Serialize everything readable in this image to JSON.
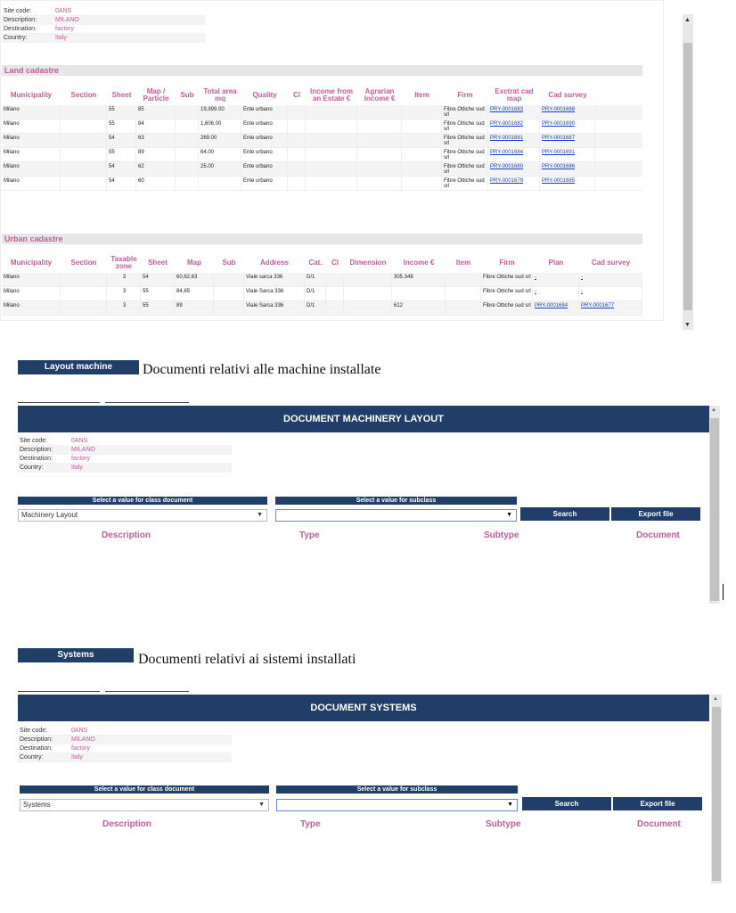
{
  "site": {
    "site_code_k": "Site code:",
    "site_code_v": "0ANS",
    "description_k": "Description:",
    "description_v": "MILANO",
    "destination_k": "Destination:",
    "destination_v": "factory",
    "country_k": "Country:",
    "country_v": "Italy"
  },
  "land": {
    "title": "Land cadastre",
    "headers": [
      "Municipality",
      "Section",
      "Sheet",
      "Map / Particle",
      "Sub",
      "Total area mq",
      "Quality",
      "Cl",
      "Income from an Estate €",
      "Agrarian Income €",
      "Item",
      "Firm",
      "Exctrat cad map",
      "Cad survey"
    ],
    "rows": [
      {
        "mun": "Milano",
        "sheet": "55",
        "map": "85",
        "area": "19,999.00",
        "quality": "Ente urbano",
        "firm": "Fibre Ottiche sud srl",
        "extract": "PRY-0001683",
        "survey": "PRY-0001688"
      },
      {
        "mun": "Milano",
        "sheet": "55",
        "map": "84",
        "area": "1,606.00",
        "quality": "Ente urbano",
        "firm": "Fibre Ottiche sud srl",
        "extract": "PRY-0001682",
        "survey": "PRY-0001690"
      },
      {
        "mun": "Milano",
        "sheet": "54",
        "map": "63",
        "area": "269.00",
        "quality": "Ente urbano",
        "firm": "Fibre Ottiche sud srl",
        "extract": "PRY-0001681",
        "survey": "PRY-0001687"
      },
      {
        "mun": "Milano",
        "sheet": "55",
        "map": "89",
        "area": "64.00",
        "quality": "Ente urbano",
        "firm": "Fibre Ottiche sud srl",
        "extract": "PRY-0001684",
        "survey": "PRY-0001691"
      },
      {
        "mun": "Milano",
        "sheet": "54",
        "map": "62",
        "area": "25.00",
        "quality": "Ente urbano",
        "firm": "Fibre Ottiche sud srl",
        "extract": "PRY-0001680",
        "survey": "PRY-0001686"
      },
      {
        "mun": "Milano",
        "sheet": "54",
        "map": "60",
        "area": "",
        "quality": "Ente urbano",
        "firm": "Fibre Ottiche sud srl",
        "extract": "PRY-0001679",
        "survey": "PRY-0001685"
      }
    ]
  },
  "urban": {
    "title": "Urban cadastre",
    "headers": [
      "Municipality",
      "Section",
      "Taxable zone",
      "Sheet",
      "Map",
      "Sub",
      "Address",
      "Cat.",
      "Cl",
      "Dimension",
      "Income €",
      "Item",
      "Firm",
      "Plan",
      "Cad survey"
    ],
    "rows": [
      {
        "mun": "Milano",
        "zone": "3",
        "sheet": "54",
        "map": "60,62,63",
        "address": "Viale sarca 336",
        "cat": "D/1",
        "income": "305.348",
        "firm": "Fibre Ottiche sud srl",
        "plan": "-",
        "survey": "-"
      },
      {
        "mun": "Milano",
        "zone": "3",
        "sheet": "55",
        "map": "84,85",
        "address": "Viale Sarca 336",
        "cat": "D/1",
        "income": "",
        "firm": "Fibre Ottiche sud srl",
        "plan": "-",
        "survey": "-"
      },
      {
        "mun": "Milano",
        "zone": "3",
        "sheet": "55",
        "map": "89",
        "address": "Viale Sarca 336",
        "cat": "D/1",
        "income": "612",
        "firm": "Fibre Ottiche sud srl",
        "plan": "PRY-0001684",
        "survey": "PRY-0001677"
      }
    ]
  },
  "machine": {
    "label": "Layout machine",
    "caption": "Documenti relativi alle machine installate",
    "title": "DOCUMENT MACHINERY LAYOUT",
    "class_hdr": "Select a value for class document",
    "subclass_hdr": "Select a value for subclass",
    "class_value": "Machinery Layout",
    "search": "Search",
    "export": "Export file",
    "col_description": "Description",
    "col_type": "Type",
    "col_subtype": "Subtype",
    "col_document": "Document"
  },
  "systems": {
    "label": "Systems",
    "caption": "Documenti relativi ai sistemi installati",
    "title": "DOCUMENT SYSTEMS",
    "class_hdr": "Select a value for class document",
    "subclass_hdr": "Select a value for subclass",
    "class_value": "Systems",
    "search": "Search",
    "export": "Export file",
    "col_description": "Description",
    "col_type": "Type",
    "col_subtype": "Subtype",
    "col_document": "Document"
  },
  "icons": {
    "up": "triangle-up",
    "down": "triangle-down",
    "dropdown": "caret-down"
  }
}
